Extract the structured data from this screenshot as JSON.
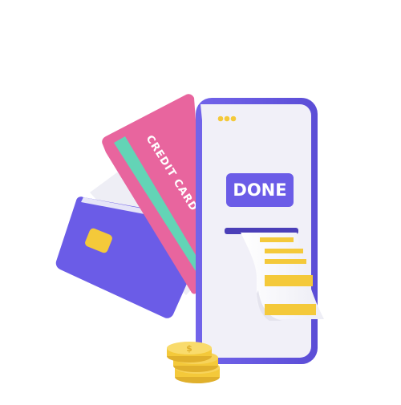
{
  "illustration": {
    "phone": {
      "status_dots": 3,
      "button_label": "DONE"
    },
    "cards": {
      "front_card_label": "CREDIT CARD"
    },
    "colors": {
      "purple": "#6B5CE7",
      "purple_dark": "#5447C8",
      "pink": "#E8659E",
      "teal": "#63D4B6",
      "yellow": "#F4C93A",
      "screen": "#F1F0F8",
      "white_card": "#F5F5FA"
    }
  }
}
